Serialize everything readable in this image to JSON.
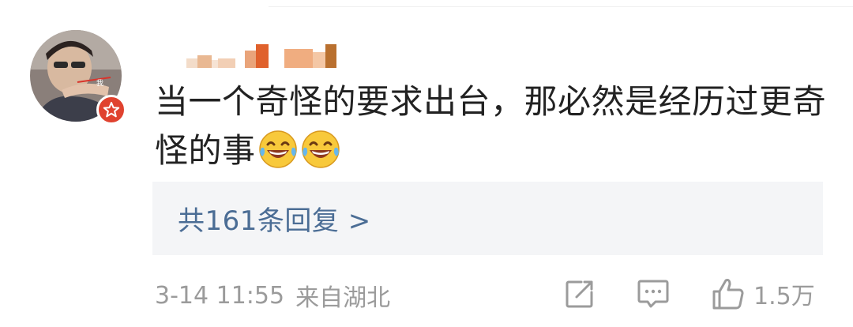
{
  "comment": {
    "text_line1": "当一个奇怪的要求出台，那必然是经历过更奇",
    "text_line2": "怪的事",
    "emojis": [
      "laugh-cry-icon",
      "laugh-cry-icon"
    ]
  },
  "replies": {
    "label": "共161条回复 >"
  },
  "meta": {
    "date": "3-14 11:55",
    "location": "来自湖北"
  },
  "actions": {
    "share_icon": "share-icon",
    "reply_icon": "comment-icon",
    "like_icon": "thumbs-up-icon",
    "like_count": "1.5万"
  },
  "colors": {
    "link_blue": "#4b6d95",
    "text_main": "#222222",
    "text_muted": "#9b9b9b",
    "box_bg": "#f4f5f7",
    "badge_red": "#e0422f"
  }
}
